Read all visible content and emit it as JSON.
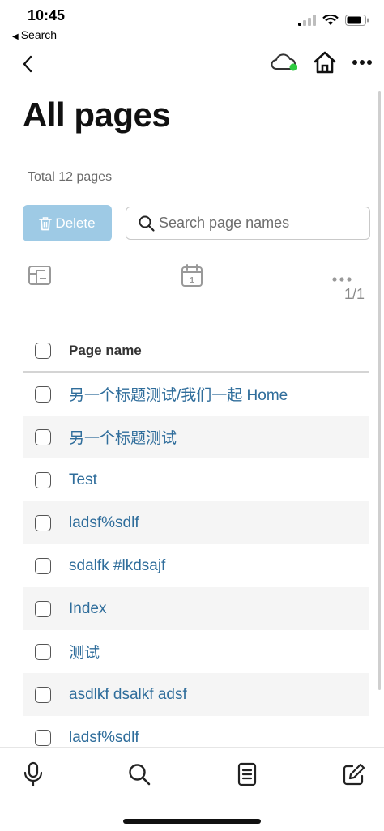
{
  "status_bar": {
    "time": "10:45",
    "back_app_label": "Search"
  },
  "nav": {
    "back_icon": "chevron-left-icon",
    "sync_icon": "cloud-icon",
    "sync_status_color": "#2ecc40",
    "home_icon": "home-icon",
    "more_icon": "more-horizontal-icon"
  },
  "page": {
    "title": "All pages",
    "total_text": "Total 12 pages"
  },
  "actions": {
    "delete_label": "Delete",
    "search_placeholder": "Search page names",
    "search_value": ""
  },
  "toolbar": {
    "journal_toggle_icon": "whiteboard-icon",
    "journals_icon": "calendar-icon",
    "calendar_day": "1",
    "more_icon": "more-horizontal-icon",
    "paging": "1/1"
  },
  "table": {
    "header": {
      "page_name_label": "Page name"
    },
    "rows": [
      {
        "name": "另一个标题测试/我们一起 Home"
      },
      {
        "name": "另一个标题测试"
      },
      {
        "name": "Test"
      },
      {
        "name": "ladsf%sdlf"
      },
      {
        "name": "sdalfk #lkdsajf"
      },
      {
        "name": "Index"
      },
      {
        "name": "测试"
      },
      {
        "name": "asdlkf dsalkf adsf"
      },
      {
        "name": "ladsf%sdlf"
      }
    ]
  },
  "bottom_bar": {
    "tabs": [
      "microphone-icon",
      "search-icon",
      "document-icon",
      "edit-icon"
    ]
  },
  "colors": {
    "link": "#2f6d9b",
    "delete_button": "#9ecae5",
    "row_alt": "#f5f5f5"
  }
}
